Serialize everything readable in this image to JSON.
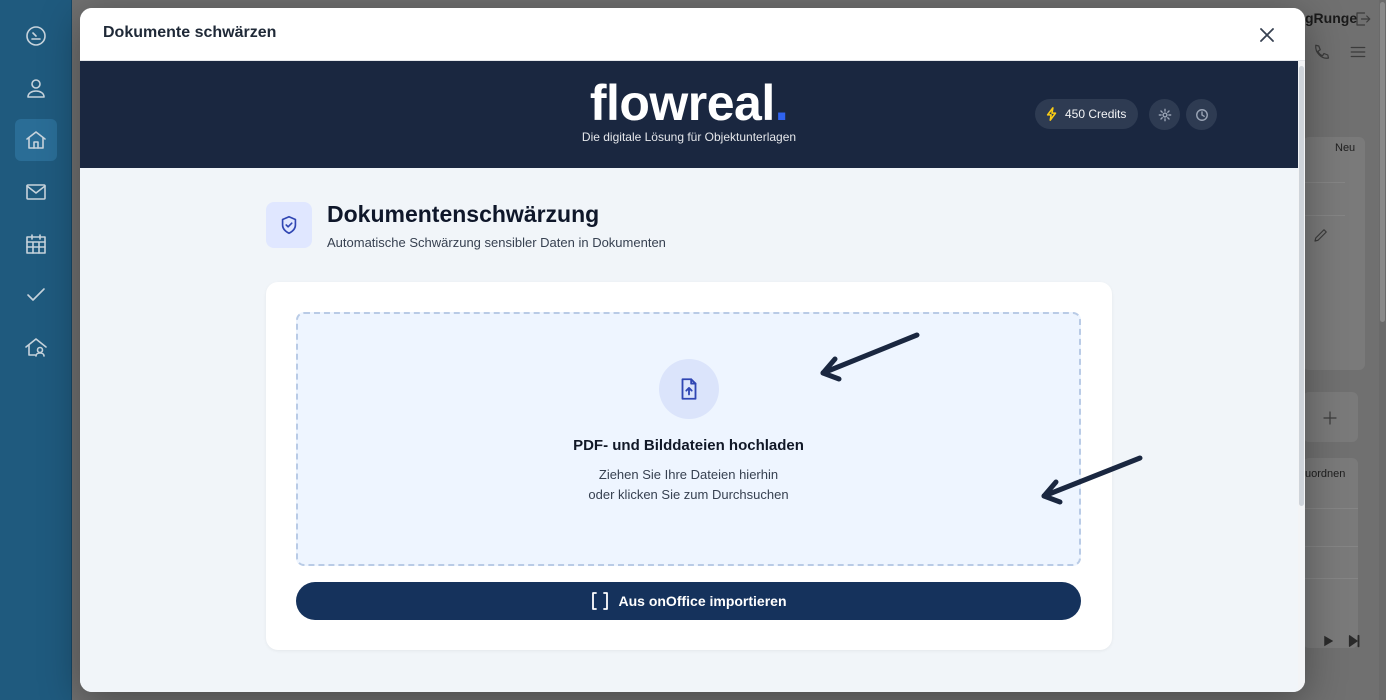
{
  "background_app": {
    "user_name": "gRunge",
    "card_label_new": "Neu",
    "card_label_assign": "uordnen"
  },
  "modal": {
    "title": "Dokumente schwärzen",
    "close_icon": "close-icon"
  },
  "banner": {
    "logo_text": "flowreal",
    "logo_dot": ".",
    "tagline": "Die digitale Lösung für Objektunterlagen",
    "credits_label": "450 Credits",
    "accent_dot_color": "#2f63f0",
    "background_color": "#1a2740"
  },
  "section": {
    "title": "Dokumentenschwärzung",
    "subtitle": "Automatische Schwärzung sensibler Daten in Dokumenten",
    "icon": "shield-check-icon"
  },
  "upload": {
    "title": "PDF- und Bilddateien hochladen",
    "line1": "Ziehen Sie Ihre Dateien hierhin",
    "line2": "oder klicken Sie zum Durchsuchen",
    "icon": "file-upload-icon"
  },
  "import_button": {
    "label": "Aus onOffice importieren",
    "color": "#15325c"
  }
}
